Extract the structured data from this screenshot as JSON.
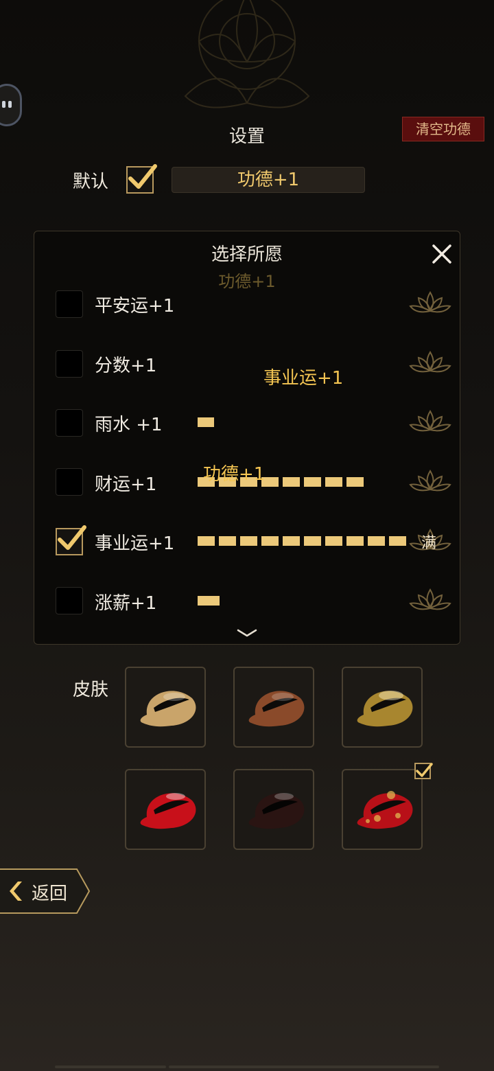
{
  "settings": {
    "title": "设置",
    "clear_button": "清空功德",
    "default_label": "默认",
    "default_checked": true,
    "default_value": "功德+1"
  },
  "wish_panel": {
    "title": "选择所愿",
    "subtitle": "功德+1",
    "items": [
      {
        "label": "平安运+1",
        "checked": false,
        "progress_segments": 0
      },
      {
        "label": "分数+1",
        "checked": false,
        "progress_segments": 0
      },
      {
        "label": "雨水 +1",
        "checked": false,
        "progress_segments": 1
      },
      {
        "label": "财运+1",
        "checked": false,
        "progress_segments": 8
      },
      {
        "label": "事业运+1",
        "checked": true,
        "progress_segments": 10,
        "status": "满"
      },
      {
        "label": "涨薪+1",
        "checked": false,
        "progress_segments": 1
      }
    ],
    "floating_texts": [
      "事业运+1",
      "功德+1"
    ]
  },
  "skins": {
    "label": "皮肤",
    "items": [
      {
        "name": "light-wood-fish",
        "color": "#c9a46a",
        "selected": false
      },
      {
        "name": "rosewood-fish",
        "color": "#8a4a2a",
        "selected": false
      },
      {
        "name": "gold-fish",
        "color": "#a8862f",
        "selected": false
      },
      {
        "name": "red-lacquer-fish",
        "color": "#c8101a",
        "selected": false
      },
      {
        "name": "ebony-fish",
        "color": "#2a1412",
        "selected": false
      },
      {
        "name": "red-gold-fish",
        "color": "#b81018",
        "selected": true
      }
    ]
  },
  "nav": {
    "back_label": "返回"
  },
  "colors": {
    "accent": "#ecc97a",
    "danger": "#5a0e0e",
    "panel": "#0b0a08"
  }
}
